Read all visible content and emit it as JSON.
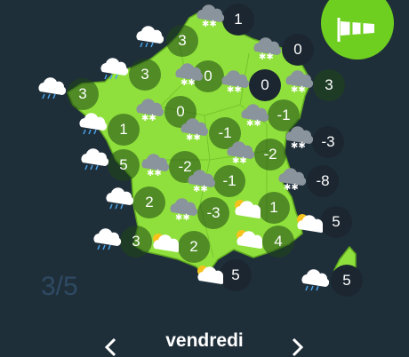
{
  "map": {
    "markers": [
      {
        "value": "1",
        "kind": "sea"
      },
      {
        "value": "3",
        "kind": "land"
      },
      {
        "value": "0",
        "kind": "sea"
      },
      {
        "value": "3",
        "kind": "land"
      },
      {
        "value": "3",
        "kind": "land"
      },
      {
        "value": "0",
        "kind": "land"
      },
      {
        "value": "0",
        "kind": "sea"
      },
      {
        "value": "3",
        "kind": "land"
      },
      {
        "value": "0",
        "kind": "land"
      },
      {
        "value": "-1",
        "kind": "land"
      },
      {
        "value": "1",
        "kind": "land"
      },
      {
        "value": "-1",
        "kind": "land"
      },
      {
        "value": "-3",
        "kind": "sea"
      },
      {
        "value": "5",
        "kind": "land"
      },
      {
        "value": "-2",
        "kind": "land"
      },
      {
        "value": "-2",
        "kind": "land"
      },
      {
        "value": "-8",
        "kind": "sea"
      },
      {
        "value": "-1",
        "kind": "land"
      },
      {
        "value": "2",
        "kind": "land"
      },
      {
        "value": "1",
        "kind": "land"
      },
      {
        "value": "-3",
        "kind": "land"
      },
      {
        "value": "5",
        "kind": "sea"
      },
      {
        "value": "3",
        "kind": "land"
      },
      {
        "value": "2",
        "kind": "land"
      },
      {
        "value": "4",
        "kind": "land"
      },
      {
        "value": "5",
        "kind": "sea"
      },
      {
        "value": "5",
        "kind": "sea"
      }
    ],
    "weather_icons": [
      {
        "type": "snow-cloud"
      },
      {
        "type": "snow-cloud"
      },
      {
        "type": "snow-cloud"
      },
      {
        "type": "rain-cloud"
      },
      {
        "type": "rain-cloud"
      },
      {
        "type": "rain-cloud"
      },
      {
        "type": "rain-cloud"
      },
      {
        "type": "snow-cloud"
      },
      {
        "type": "snow-cloud"
      },
      {
        "type": "snow-cloud"
      },
      {
        "type": "snow-cloud"
      },
      {
        "type": "snow-cloud"
      },
      {
        "type": "snow-cloud"
      },
      {
        "type": "snow-cloud"
      },
      {
        "type": "snow-cloud"
      },
      {
        "type": "snow-cloud"
      },
      {
        "type": "snow-cloud"
      },
      {
        "type": "rain-cloud"
      },
      {
        "type": "rain-cloud"
      },
      {
        "type": "rain-cloud"
      },
      {
        "type": "sun-cloud"
      },
      {
        "type": "sun-cloud"
      },
      {
        "type": "sun-cloud"
      },
      {
        "type": "sun-cloud"
      },
      {
        "type": "sun-cloud"
      },
      {
        "type": "rain-cloud"
      },
      {
        "type": "snow-cloud"
      }
    ],
    "land_color": "#8fe03c",
    "background_color": "#1f2f3a"
  },
  "pager": {
    "current": "3/5"
  },
  "navigation": {
    "day": "vendredi",
    "prev_icon": "chevron-left-icon",
    "next_icon": "chevron-right-icon"
  },
  "wind_button": {
    "icon": "windsock-icon",
    "color": "#6fcf20"
  }
}
